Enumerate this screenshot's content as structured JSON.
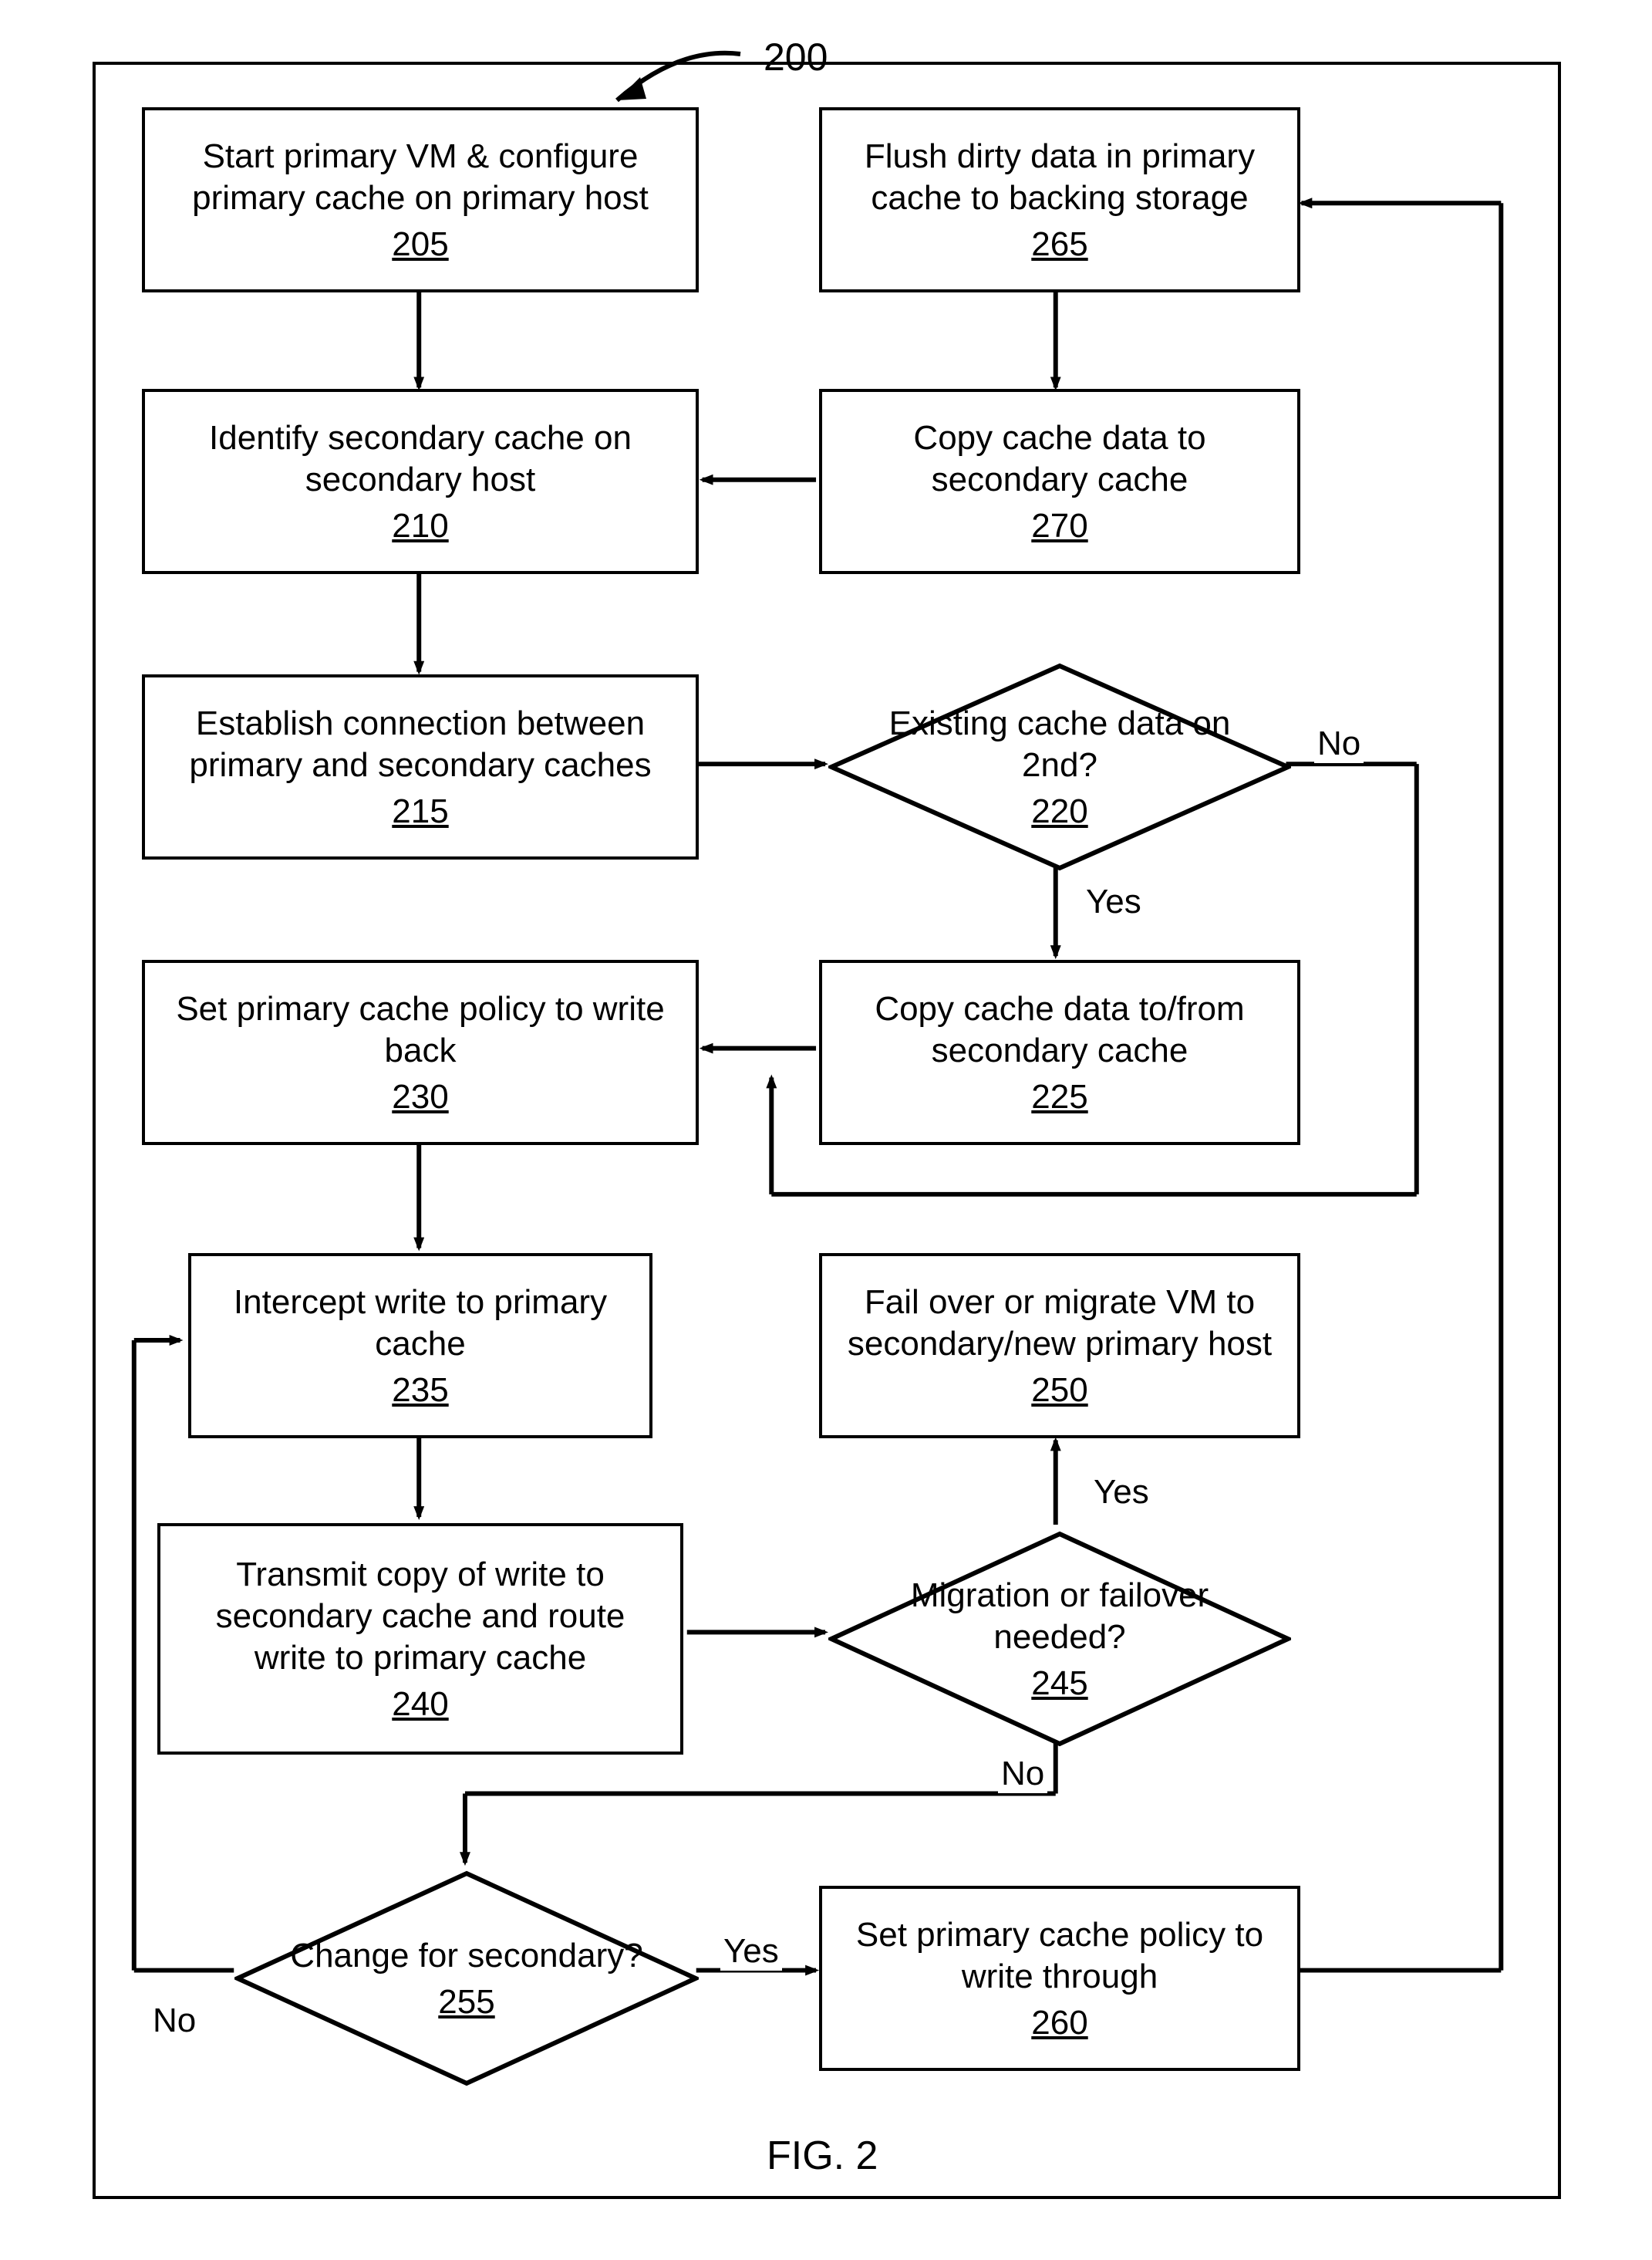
{
  "figure": {
    "number_label": "200",
    "caption": "FIG. 2"
  },
  "edge_labels": {
    "yes": "Yes",
    "no": "No"
  },
  "nodes": {
    "n205": {
      "text": "Start primary VM & configure primary cache on primary host",
      "ref": "205"
    },
    "n210": {
      "text": "Identify secondary cache on secondary host",
      "ref": "210"
    },
    "n215": {
      "text": "Establish connection between primary and secondary caches",
      "ref": "215"
    },
    "n220": {
      "text": "Existing cache data on 2nd?",
      "ref": "220"
    },
    "n225": {
      "text": "Copy cache data to/from secondary cache",
      "ref": "225"
    },
    "n230": {
      "text": "Set primary cache policy to write back",
      "ref": "230"
    },
    "n235": {
      "text": "Intercept write to primary cache",
      "ref": "235"
    },
    "n240": {
      "text": "Transmit copy of write to secondary cache and route write to primary cache",
      "ref": "240"
    },
    "n245": {
      "text": "Migration or failover needed?",
      "ref": "245"
    },
    "n250": {
      "text": "Fail over or migrate VM to secondary/new primary host",
      "ref": "250"
    },
    "n255": {
      "text": "Change for secondary?",
      "ref": "255"
    },
    "n260": {
      "text": "Set primary cache policy to write through",
      "ref": "260"
    },
    "n265": {
      "text": "Flush dirty data in primary cache to backing storage",
      "ref": "265"
    },
    "n270": {
      "text": "Copy cache data to secondary cache",
      "ref": "270"
    }
  }
}
